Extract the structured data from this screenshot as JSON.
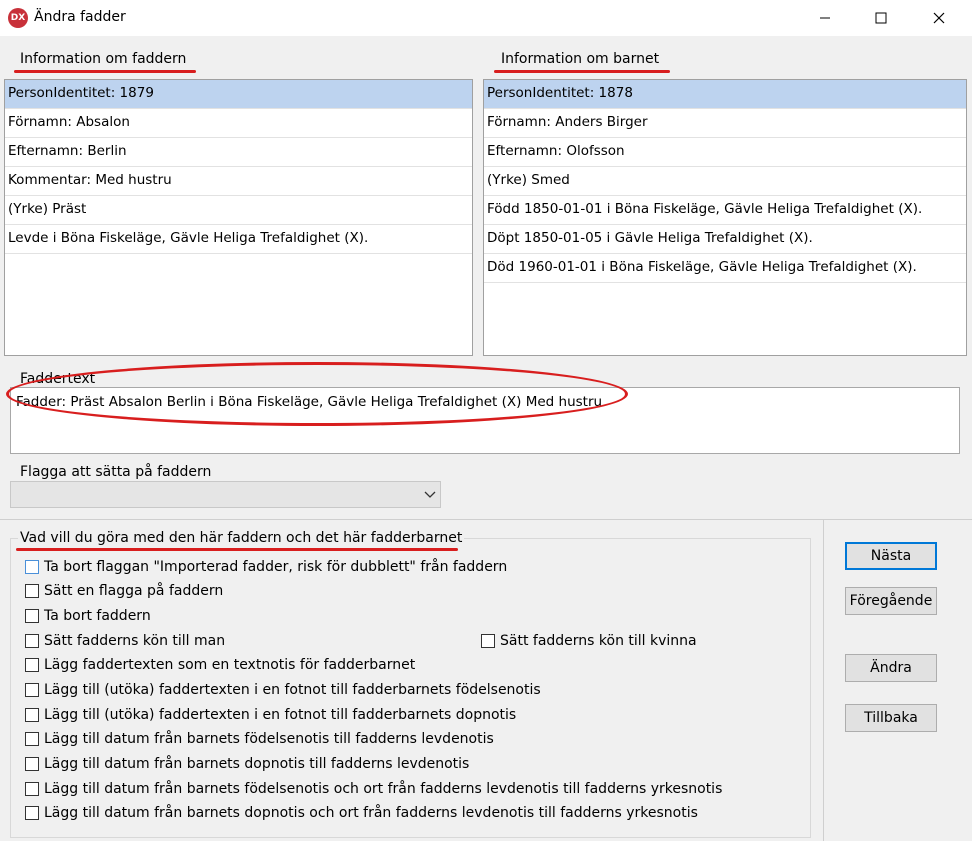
{
  "window": {
    "title": "Ändra fadder",
    "icon_text": "DX",
    "icon_color": "#c8313a",
    "controls": [
      "minimize-icon",
      "maximize-icon",
      "close-icon"
    ]
  },
  "godparent_panel": {
    "header": "Information om faddern",
    "items": [
      "PersonIdentitet: 1879",
      "Förnamn: Absalon",
      "Efternamn: Berlin",
      "Kommentar: Med hustru",
      "(Yrke) Präst",
      "Levde i Böna Fiskeläge, Gävle Heliga Trefaldighet (X)."
    ],
    "selected_index": 0
  },
  "child_panel": {
    "header": "Information om barnet",
    "items": [
      "PersonIdentitet: 1878",
      "Förnamn: Anders Birger",
      "Efternamn: Olofsson",
      "(Yrke) Smed",
      "Född 1850-01-01 i Böna Fiskeläge, Gävle Heliga Trefaldighet (X).",
      "Döpt 1850-01-05 i Gävle Heliga Trefaldighet (X).",
      "Död 1960-01-01 i Böna Fiskeläge, Gävle Heliga Trefaldighet (X)."
    ],
    "selected_index": 0
  },
  "faddertext": {
    "label": "Faddertext",
    "value": "Fadder: Präst Absalon Berlin i Böna Fiskeläge, Gävle Heliga Trefaldighet (X) Med hustru"
  },
  "flag": {
    "label": "Flagga att sätta på faddern",
    "selected": ""
  },
  "actions": {
    "header": "Vad vill du göra med den här faddern och det här fadderbarnet",
    "options": [
      "Ta bort flaggan \"Importerad fadder, risk för dubblett\" från faddern",
      "Sätt en flagga på faddern",
      "Ta bort faddern",
      "Sätt fadderns kön till man",
      "Lägg faddertexten som en textnotis för fadderbarnet",
      "Lägg till (utöka) faddertexten i en fotnot till fadderbarnets födelsenotis",
      "Lägg till (utöka) faddertexten i en fotnot till fadderbarnets dopnotis",
      "Lägg till datum från barnets födelsenotis till fadderns levdenotis",
      "Lägg till datum från barnets dopnotis till fadderns levdenotis",
      "Lägg till datum från barnets födelsenotis och ort från fadderns levdenotis till fadderns yrkesnotis",
      "Lägg till datum från barnets dopnotis och ort från fadderns levdenotis till fadderns yrkesnotis"
    ],
    "option_female": "Sätt fadderns kön till kvinna"
  },
  "buttons": {
    "next": "Nästa",
    "previous": "Föregående",
    "change": "Ändra",
    "back": "Tillbaka"
  },
  "colors": {
    "annotation_red": "#d81e1e",
    "selection": "#bdd3ef",
    "default_button_border": "#0078d7"
  }
}
